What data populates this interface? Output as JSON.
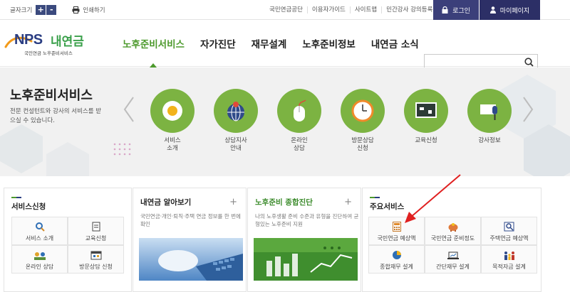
{
  "topbar": {
    "font_size_label": "글자크기",
    "font_plus": "+",
    "font_minus": "-",
    "print_label": "인쇄하기",
    "links": [
      "국민연금공단",
      "이용자가이드",
      "사이트맵",
      "민간강사 강의등록"
    ],
    "login_label": "로그인",
    "mypage_label": "마이페이지"
  },
  "logo": {
    "nps": "NPS",
    "name": "내연금",
    "sub": "국민연금 노후준비서비스"
  },
  "gnb": [
    "노후준비서비스",
    "자가진단",
    "재무설계",
    "노후준비정보",
    "내연금 소식"
  ],
  "search": {
    "placeholder": ""
  },
  "hero": {
    "title": "노후준비서비스",
    "desc": "전문 컨설턴트와 강사의 서비스를 받으실 수 있습니다.",
    "services": [
      {
        "label": "서비스\n소개",
        "icon": "egg-icon"
      },
      {
        "label": "상담지사\n안내",
        "icon": "globe-pin-icon"
      },
      {
        "label": "온라인\n상담",
        "icon": "mouse-icon"
      },
      {
        "label": "방문상담\n신청",
        "icon": "clock-icon"
      },
      {
        "label": "교육신청",
        "icon": "board-icon"
      },
      {
        "label": "강사정보",
        "icon": "microphone-icon"
      }
    ]
  },
  "panels": {
    "apply": {
      "title": "서비스신청",
      "items": [
        "서비스 소개",
        "교육신청",
        "온라인 상담",
        "방문상담 신청"
      ]
    },
    "mypension": {
      "title": "내연금 알아보기",
      "plus": "+",
      "desc": "국민연금·개인·퇴직·주택 연금 정보를 한 번에 확인"
    },
    "diagnosis": {
      "title": "노후준비 종합진단",
      "plus": "+",
      "desc": "나의 노후생활 준비 수준과 유형을 진단하여 균형있는 노후준비 지원"
    },
    "main": {
      "title": "주요서비스",
      "items": [
        "국민연금 예상액",
        "국민연금 준비정도",
        "주택연금 예상액",
        "종합재무 설계",
        "간단재무 설계",
        "목적자금 설계"
      ]
    }
  },
  "colors": {
    "accent_green": "#4d9a2d",
    "navy": "#2c2f66",
    "circle_green": "#7cb342",
    "arrow_red": "#e02020"
  }
}
